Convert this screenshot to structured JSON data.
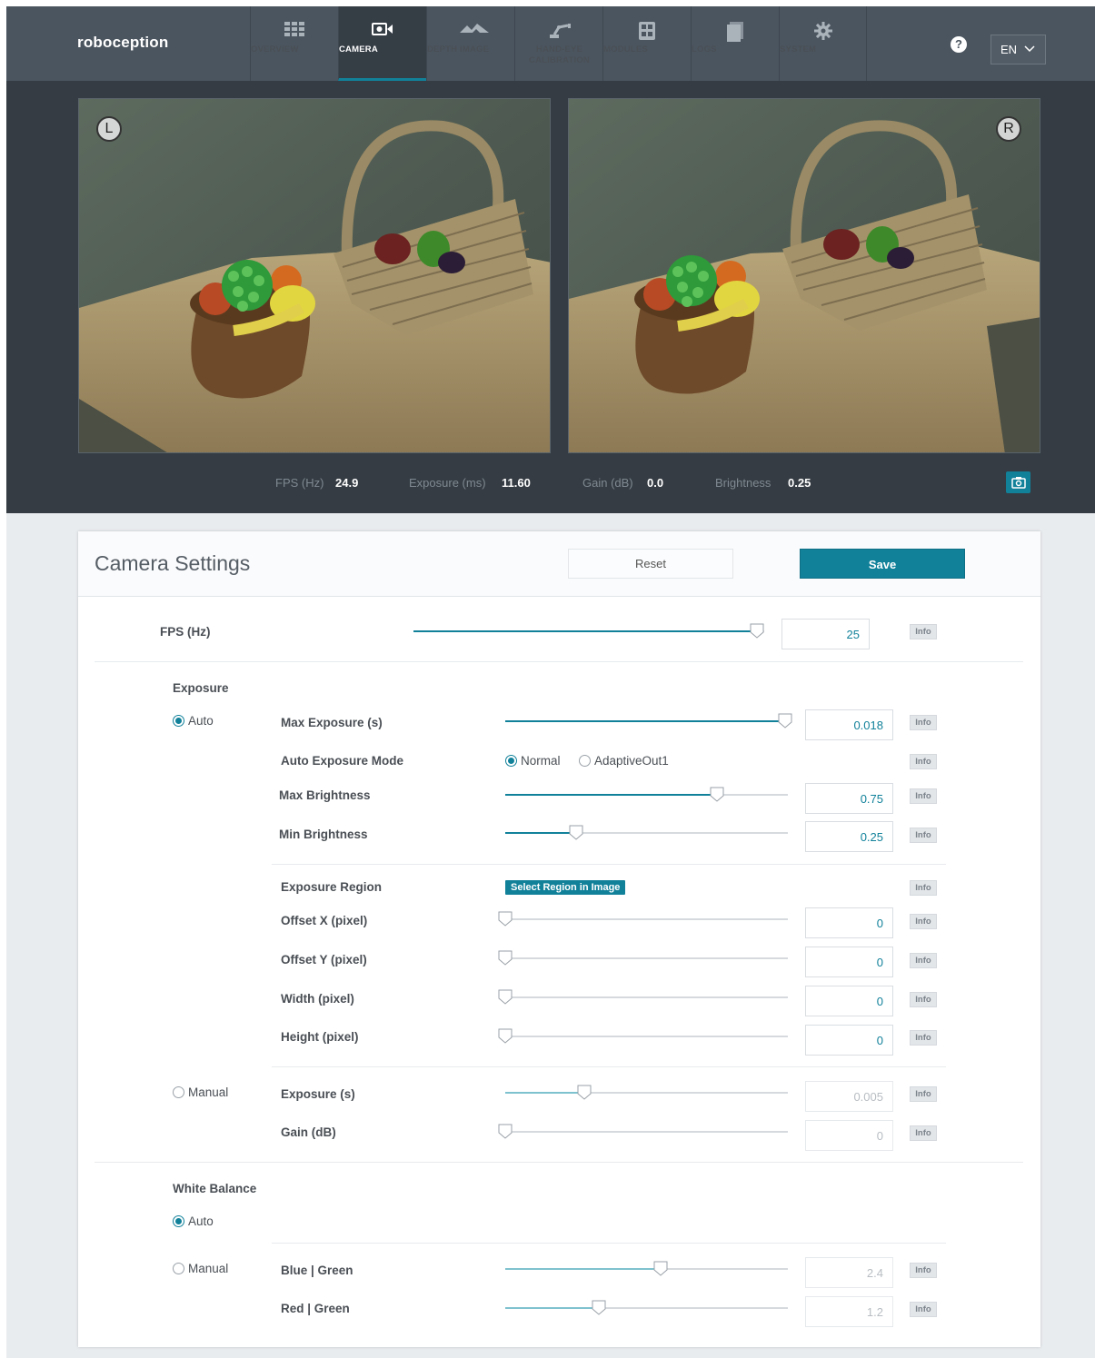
{
  "brand": "roboception",
  "nav": [
    {
      "label": "OVERVIEW",
      "icon": "grid-icon"
    },
    {
      "label": "CAMERA",
      "icon": "camera-icon"
    },
    {
      "label": "DEPTH IMAGE",
      "icon": "depth-icon"
    },
    {
      "label": "HAND-EYE CALIBRATION",
      "icon": "robot-arm-icon"
    },
    {
      "label": "MODULES",
      "icon": "modules-icon"
    },
    {
      "label": "LOGS",
      "icon": "document-icon"
    },
    {
      "label": "SYSTEM",
      "icon": "gear-icon"
    }
  ],
  "help": "?",
  "language": "EN",
  "camera": {
    "left_badge": "L",
    "right_badge": "R",
    "stats": {
      "fps_label": "FPS (Hz)",
      "fps_value": "24.9",
      "exposure_label": "Exposure (ms)",
      "exposure_value": "11.60",
      "gain_label": "Gain (dB)",
      "gain_value": "0.0",
      "brightness_label": "Brightness",
      "brightness_value": "0.25"
    }
  },
  "settings": {
    "title": "Camera Settings",
    "reset_label": "Reset",
    "save_label": "Save",
    "info_label": "Info",
    "fps": {
      "label": "FPS (Hz)",
      "value": "25",
      "level": 0.98
    },
    "exposure": {
      "section": "Exposure",
      "auto_label": "Auto",
      "manual_label": "Manual",
      "mode": "auto",
      "max_exposure": {
        "label": "Max Exposure (s)",
        "value": "0.018",
        "level": 0.99
      },
      "auto_mode": {
        "label": "Auto Exposure Mode",
        "options": [
          "Normal",
          "AdaptiveOut1"
        ],
        "selected": "Normal"
      },
      "max_brightness": {
        "label": "Max Brightness",
        "value": "0.75",
        "level": 0.75
      },
      "min_brightness": {
        "label": "Min Brightness",
        "value": "0.25",
        "level": 0.25
      },
      "region": {
        "label": "Exposure Region",
        "button": "Select Region in Image"
      },
      "offset_x": {
        "label": "Offset X (pixel)",
        "value": "0",
        "level": 0
      },
      "offset_y": {
        "label": "Offset Y (pixel)",
        "value": "0",
        "level": 0
      },
      "width": {
        "label": "Width (pixel)",
        "value": "0",
        "level": 0
      },
      "height": {
        "label": "Height (pixel)",
        "value": "0",
        "level": 0
      },
      "manual_exposure": {
        "label": "Exposure (s)",
        "value": "0.005",
        "level": 0.28
      },
      "manual_gain": {
        "label": "Gain (dB)",
        "value": "0",
        "level": 0
      }
    },
    "white_balance": {
      "section": "White Balance",
      "auto_label": "Auto",
      "manual_label": "Manual",
      "mode": "auto",
      "blue_green": {
        "label": "Blue | Green",
        "value": "2.4",
        "level": 0.55
      },
      "red_green": {
        "label": "Red | Green",
        "value": "1.2",
        "level": 0.33
      }
    }
  },
  "colors": {
    "accent": "#11819a",
    "nav_bg": "#4b555f",
    "camera_bg": "#353c43"
  }
}
